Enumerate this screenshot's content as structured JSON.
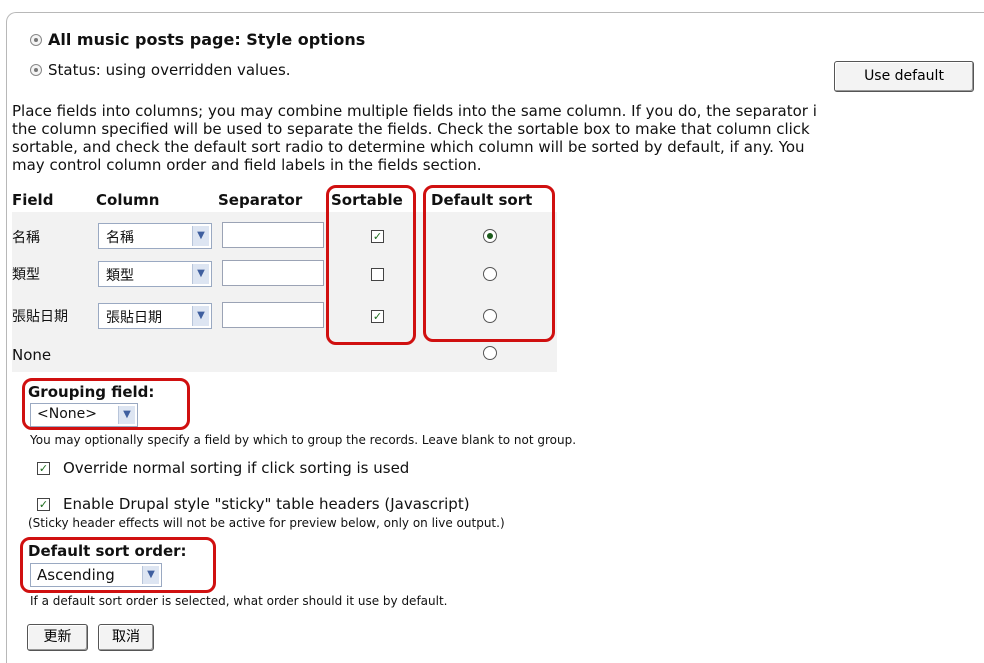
{
  "header": {
    "title": "All music posts page: Style options",
    "status": "Status: using overridden values.",
    "use_default_label": "Use default"
  },
  "description": [
    "Place fields into columns; you may combine multiple fields into the same column. If you do, the separator i",
    "the column specified will be used to separate the fields. Check the sortable box to make that column click",
    "sortable, and check the default sort radio to determine which column will be sorted by default, if any. You",
    "may control column order and field labels in the fields section."
  ],
  "table": {
    "headers": {
      "field": "Field",
      "column": "Column",
      "separator": "Separator",
      "sortable": "Sortable",
      "default_sort": "Default sort"
    },
    "rows": [
      {
        "field": "名稱",
        "column": "名稱",
        "separator": "",
        "sortable": true,
        "default_sort": true
      },
      {
        "field": "類型",
        "column": "類型",
        "separator": "",
        "sortable": false,
        "default_sort": false
      },
      {
        "field": "張貼日期",
        "column": "張貼日期",
        "separator": "",
        "sortable": true,
        "default_sort": false
      }
    ],
    "none_label": "None"
  },
  "grouping": {
    "label": "Grouping field:",
    "value": "<None>",
    "help": "You may optionally specify a field by which to group the records. Leave blank to not group."
  },
  "options": {
    "override_sorting": {
      "label": "Override normal sorting if click sorting is used",
      "checked": true
    },
    "sticky_headers": {
      "label": "Enable Drupal style \"sticky\" table headers (Javascript)",
      "checked": true,
      "note": "(Sticky header effects will not be active for preview below, only on live output.)"
    }
  },
  "sort_order": {
    "label": "Default sort order:",
    "value": "Ascending",
    "help": "If a default sort order is selected, what order should it use by default."
  },
  "actions": {
    "update_label": "更新",
    "cancel_label": "取消"
  },
  "colors": {
    "highlight": "#d01010",
    "select_border": "#9aa9c2",
    "check": "#1a6b1a"
  }
}
